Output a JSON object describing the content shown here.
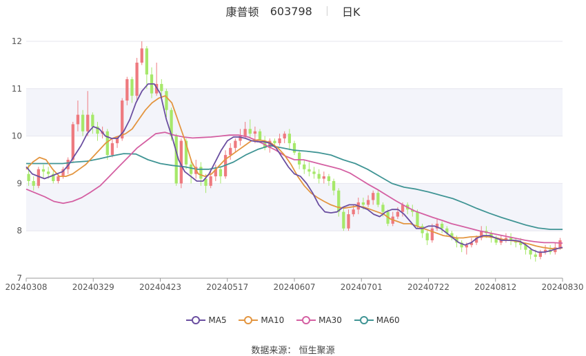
{
  "title": {
    "name": "康普顿",
    "code": "603798",
    "period": "日K"
  },
  "source_label": "数据来源：",
  "source_name": "恒生聚源",
  "chart_data": {
    "type": "candlestick",
    "y_ticks": [
      "7",
      "8",
      "9",
      "10",
      "11",
      "12"
    ],
    "ylim": [
      7,
      12
    ],
    "x_ticks": [
      "20240308",
      "20240329",
      "20240423",
      "20240517",
      "20240607",
      "20240701",
      "20240722",
      "20240812",
      "20240830"
    ],
    "colors": {
      "up": "#ee7a7f",
      "down": "#a6e86a",
      "MA5": "#6a4ea0",
      "MA10": "#e3953f",
      "MA30": "#d45fa2",
      "MA60": "#3f9494"
    },
    "series": [
      {
        "name": "MA5"
      },
      {
        "name": "MA10"
      },
      {
        "name": "MA30"
      },
      {
        "name": "MA60"
      }
    ],
    "ohlc": [
      [
        9.2,
        9.05,
        9.4,
        8.95
      ],
      [
        9.05,
        8.95,
        9.15,
        8.85
      ],
      [
        8.95,
        9.3,
        9.35,
        8.9
      ],
      [
        9.3,
        9.25,
        9.4,
        9.1
      ],
      [
        9.25,
        9.2,
        9.35,
        9.1
      ],
      [
        9.2,
        9.05,
        9.3,
        9.0
      ],
      [
        9.05,
        9.15,
        9.2,
        9.0
      ],
      [
        9.15,
        9.3,
        9.35,
        9.1
      ],
      [
        9.3,
        9.5,
        9.55,
        9.2
      ],
      [
        9.5,
        10.25,
        10.3,
        9.45
      ],
      [
        10.25,
        10.45,
        10.75,
        10.1
      ],
      [
        10.45,
        10.1,
        10.55,
        10.0
      ],
      [
        10.1,
        10.45,
        10.95,
        10.0
      ],
      [
        10.45,
        10.2,
        10.5,
        10.05
      ],
      [
        10.2,
        10.05,
        10.3,
        9.9
      ],
      [
        10.05,
        10.1,
        10.2,
        9.95
      ],
      [
        10.1,
        9.6,
        10.15,
        9.5
      ],
      [
        9.6,
        9.85,
        9.95,
        9.55
      ],
      [
        9.85,
        9.95,
        10.0,
        9.75
      ],
      [
        9.95,
        10.75,
        10.8,
        9.9
      ],
      [
        10.75,
        11.2,
        11.25,
        10.65
      ],
      [
        11.2,
        10.85,
        11.25,
        10.7
      ],
      [
        10.85,
        11.55,
        11.65,
        10.75
      ],
      [
        11.55,
        11.85,
        12.0,
        11.5
      ],
      [
        11.85,
        11.3,
        11.9,
        11.0
      ],
      [
        11.3,
        10.9,
        11.45,
        10.8
      ],
      [
        10.9,
        11.1,
        11.55,
        10.85
      ],
      [
        11.1,
        10.95,
        11.2,
        10.8
      ],
      [
        10.95,
        10.55,
        11.0,
        10.4
      ],
      [
        10.55,
        10.0,
        10.6,
        9.9
      ],
      [
        10.0,
        9.0,
        10.05,
        8.95
      ],
      [
        9.0,
        9.9,
        9.95,
        8.9
      ],
      [
        9.9,
        9.4,
        9.95,
        9.3
      ],
      [
        9.4,
        9.2,
        9.5,
        9.0
      ],
      [
        9.2,
        9.35,
        9.5,
        9.1
      ],
      [
        9.35,
        9.1,
        9.45,
        8.95
      ],
      [
        9.1,
        8.95,
        9.2,
        8.8
      ],
      [
        8.95,
        9.15,
        9.25,
        8.9
      ],
      [
        9.15,
        9.3,
        9.4,
        9.05
      ],
      [
        9.3,
        9.15,
        9.35,
        9.0
      ],
      [
        9.15,
        9.6,
        9.7,
        9.1
      ],
      [
        9.6,
        9.75,
        9.85,
        9.5
      ],
      [
        9.75,
        9.9,
        9.95,
        9.65
      ],
      [
        9.9,
        10.0,
        10.15,
        9.8
      ],
      [
        10.0,
        10.15,
        10.3,
        9.95
      ],
      [
        10.15,
        10.05,
        10.35,
        9.95
      ],
      [
        10.05,
        10.1,
        10.2,
        9.85
      ],
      [
        10.1,
        9.9,
        10.15,
        9.85
      ],
      [
        9.9,
        9.75,
        10.0,
        9.7
      ],
      [
        9.75,
        9.9,
        9.95,
        9.65
      ],
      [
        9.9,
        9.85,
        9.95,
        9.75
      ],
      [
        9.85,
        9.95,
        10.05,
        9.8
      ],
      [
        9.95,
        10.05,
        10.1,
        9.85
      ],
      [
        10.05,
        9.85,
        10.15,
        9.7
      ],
      [
        9.85,
        9.65,
        9.9,
        9.6
      ],
      [
        9.65,
        9.4,
        9.7,
        9.3
      ],
      [
        9.4,
        9.3,
        9.5,
        9.2
      ],
      [
        9.3,
        9.25,
        9.45,
        9.15
      ],
      [
        9.25,
        9.2,
        9.35,
        9.1
      ],
      [
        9.2,
        9.1,
        9.3,
        9.0
      ],
      [
        9.1,
        9.15,
        9.25,
        9.0
      ],
      [
        9.15,
        9.05,
        9.2,
        8.95
      ],
      [
        9.05,
        8.85,
        9.1,
        8.75
      ],
      [
        8.85,
        8.4,
        8.9,
        8.3
      ],
      [
        8.4,
        8.05,
        8.5,
        8.0
      ],
      [
        8.05,
        8.35,
        8.45,
        8.0
      ],
      [
        8.35,
        8.45,
        8.55,
        8.3
      ],
      [
        8.45,
        8.6,
        8.7,
        8.35
      ],
      [
        8.6,
        8.55,
        8.7,
        8.45
      ],
      [
        8.55,
        8.65,
        8.75,
        8.5
      ],
      [
        8.65,
        8.8,
        8.85,
        8.55
      ],
      [
        8.8,
        8.55,
        8.85,
        8.5
      ],
      [
        8.55,
        8.4,
        8.6,
        8.3
      ],
      [
        8.4,
        8.15,
        8.45,
        8.1
      ],
      [
        8.15,
        8.3,
        8.4,
        8.1
      ],
      [
        8.3,
        8.4,
        8.5,
        8.25
      ],
      [
        8.4,
        8.55,
        8.6,
        8.3
      ],
      [
        8.55,
        8.45,
        8.6,
        8.35
      ],
      [
        8.45,
        8.4,
        8.55,
        8.3
      ],
      [
        8.4,
        8.1,
        8.45,
        8.05
      ],
      [
        8.1,
        7.95,
        8.15,
        7.85
      ],
      [
        7.95,
        7.8,
        8.0,
        7.7
      ],
      [
        7.8,
        8.05,
        8.15,
        7.75
      ],
      [
        8.05,
        8.15,
        8.25,
        8.0
      ],
      [
        8.15,
        8.05,
        8.2,
        7.95
      ],
      [
        8.05,
        7.95,
        8.1,
        7.9
      ],
      [
        7.95,
        7.85,
        8.0,
        7.8
      ],
      [
        7.85,
        7.75,
        7.9,
        7.65
      ],
      [
        7.75,
        7.65,
        7.8,
        7.55
      ],
      [
        7.65,
        7.7,
        7.75,
        7.5
      ],
      [
        7.7,
        7.75,
        7.85,
        7.65
      ],
      [
        7.75,
        7.85,
        7.9,
        7.7
      ],
      [
        7.85,
        8.0,
        8.1,
        7.8
      ],
      [
        8.0,
        7.95,
        8.1,
        7.85
      ],
      [
        7.95,
        7.85,
        8.0,
        7.75
      ],
      [
        7.85,
        7.75,
        7.9,
        7.7
      ],
      [
        7.75,
        7.8,
        7.9,
        7.7
      ],
      [
        7.8,
        7.85,
        7.95,
        7.75
      ],
      [
        7.85,
        7.8,
        7.95,
        7.7
      ],
      [
        7.8,
        7.75,
        7.85,
        7.65
      ],
      [
        7.75,
        7.7,
        7.85,
        7.6
      ],
      [
        7.7,
        7.6,
        7.75,
        7.5
      ],
      [
        7.6,
        7.5,
        7.65,
        7.4
      ],
      [
        7.5,
        7.45,
        7.6,
        7.35
      ],
      [
        7.45,
        7.55,
        7.6,
        7.4
      ],
      [
        7.55,
        7.6,
        7.7,
        7.5
      ],
      [
        7.6,
        7.55,
        7.7,
        7.5
      ],
      [
        7.55,
        7.65,
        7.75,
        7.5
      ],
      [
        7.65,
        7.8,
        7.85,
        7.6
      ]
    ],
    "ma": {
      "MA5": [
        9.35,
        9.2,
        9.15,
        9.1,
        9.15,
        9.2,
        9.25,
        9.4,
        9.6,
        9.8,
        10.05,
        10.2,
        10.15,
        10.0,
        9.95,
        9.95,
        10.1,
        10.35,
        10.7,
        10.95,
        11.1,
        11.1,
        10.9,
        10.35,
        9.95,
        9.5,
        9.25,
        9.15,
        9.05,
        9.05,
        9.2,
        9.45,
        9.7,
        9.9,
        9.98,
        9.98,
        9.95,
        9.9,
        9.88,
        9.88,
        9.85,
        9.75,
        9.55,
        9.35,
        9.2,
        9.15,
        9.0,
        8.8,
        8.55,
        8.4,
        8.38,
        8.4,
        8.5,
        8.55,
        8.55,
        8.5,
        8.45,
        8.35,
        8.3,
        8.4,
        8.45,
        8.45,
        8.35,
        8.2,
        8.05,
        8.05,
        8.1,
        8.1,
        8.05,
        7.95,
        7.85,
        7.75,
        7.7,
        7.75,
        7.85,
        7.9,
        7.9,
        7.85,
        7.8,
        7.8,
        7.8,
        7.78,
        7.7,
        7.6,
        7.55,
        7.55,
        7.58,
        7.62,
        7.65
      ],
      "MA10": [
        9.3,
        9.45,
        9.55,
        9.5,
        9.3,
        9.15,
        9.15,
        9.2,
        9.3,
        9.4,
        9.55,
        9.7,
        9.85,
        9.95,
        10.0,
        10.05,
        10.15,
        10.35,
        10.55,
        10.7,
        10.8,
        10.85,
        10.7,
        10.3,
        9.9,
        9.45,
        9.2,
        9.15,
        9.2,
        9.35,
        9.5,
        9.6,
        9.7,
        9.8,
        9.9,
        9.92,
        9.9,
        9.85,
        9.75,
        9.6,
        9.4,
        9.15,
        8.95,
        8.8,
        8.7,
        8.62,
        8.55,
        8.5,
        8.48,
        8.5,
        8.52,
        8.5,
        8.45,
        8.4,
        8.35,
        8.25,
        8.2,
        8.15,
        8.15,
        8.1,
        8.05,
        8.0,
        7.95,
        7.9,
        7.88,
        7.85,
        7.85,
        7.87,
        7.88,
        7.88,
        7.87,
        7.85,
        7.82,
        7.8,
        7.78,
        7.75,
        7.72,
        7.68,
        7.65,
        7.63,
        7.62,
        7.64
      ],
      "MA30": [
        8.88,
        8.8,
        8.72,
        8.62,
        8.58,
        8.62,
        8.7,
        8.82,
        8.95,
        9.15,
        9.35,
        9.55,
        9.75,
        9.9,
        10.05,
        10.08,
        10.02,
        9.98,
        9.96,
        9.97,
        9.98,
        10.0,
        10.02,
        10.02,
        9.98,
        9.9,
        9.8,
        9.7,
        9.58,
        9.5,
        9.5,
        9.45,
        9.4,
        9.35,
        9.3,
        9.22,
        9.1,
        8.98,
        8.87,
        8.75,
        8.63,
        8.52,
        8.42,
        8.35,
        8.28,
        8.22,
        8.15,
        8.1,
        8.05,
        8.0,
        7.96,
        7.92,
        7.88,
        7.84,
        7.8,
        7.77,
        7.75,
        7.75,
        7.74
      ],
      "MA60": [
        9.42,
        9.42,
        9.42,
        9.42,
        9.45,
        9.47,
        9.52,
        9.58,
        9.63,
        9.62,
        9.5,
        9.42,
        9.38,
        9.35,
        9.3,
        9.3,
        9.35,
        9.45,
        9.6,
        9.72,
        9.8,
        9.75,
        9.7,
        9.68,
        9.65,
        9.6,
        9.5,
        9.42,
        9.3,
        9.15,
        9.0,
        8.92,
        8.88,
        8.82,
        8.75,
        8.68,
        8.58,
        8.47,
        8.37,
        8.28,
        8.2,
        8.12,
        8.06,
        8.03,
        8.03
      ]
    }
  }
}
